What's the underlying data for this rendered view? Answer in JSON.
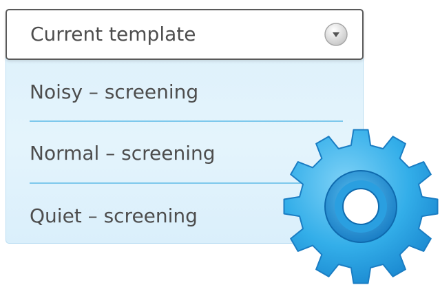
{
  "dropdown": {
    "selected_label": "Current template",
    "options": [
      {
        "label": "Noisy – screening"
      },
      {
        "label": "Normal – screening"
      },
      {
        "label": "Quiet – screening"
      }
    ]
  },
  "icons": {
    "dropdown_arrow": "chevron-down-icon",
    "settings": "gear-icon"
  },
  "colors": {
    "list_background": "#e2f3fc",
    "divider": "#7dc8ec",
    "text": "#4d4d4d",
    "gear_blue": "#29a6e6"
  }
}
